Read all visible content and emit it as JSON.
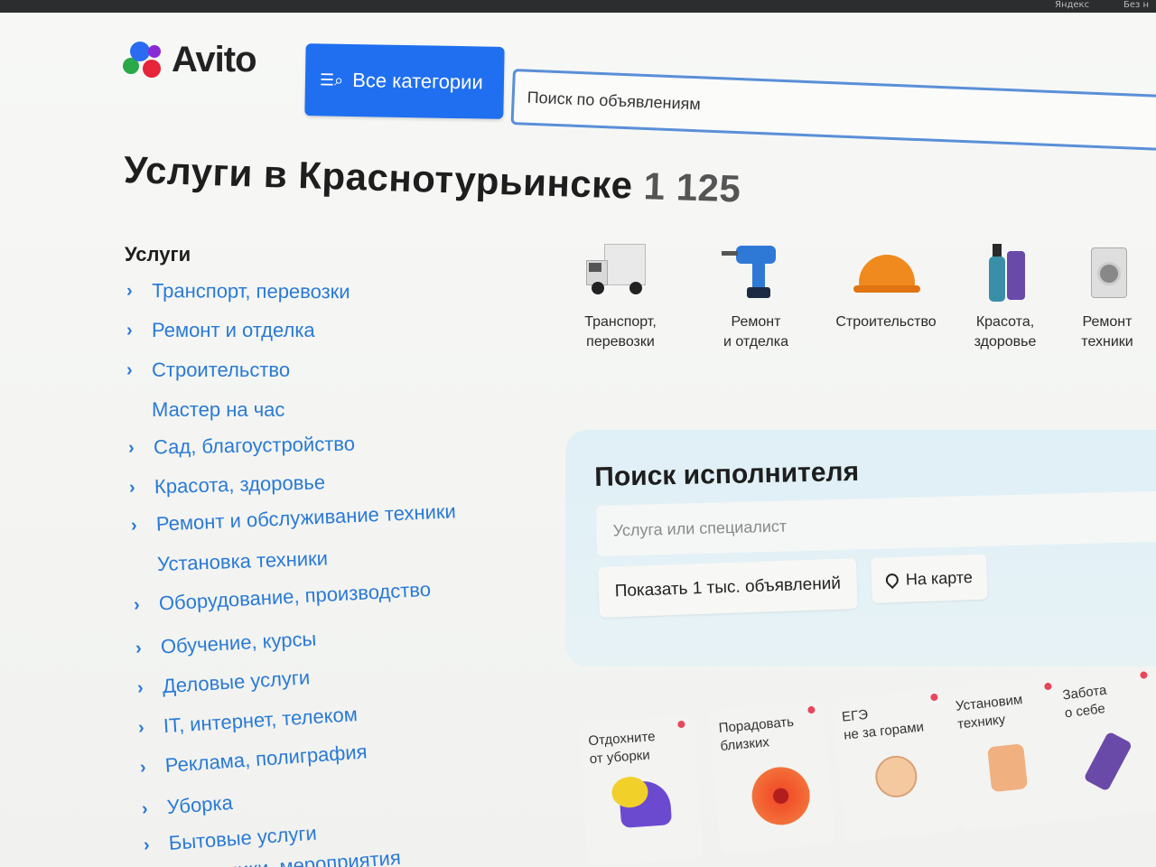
{
  "browser": {
    "bookmarks": [
      "Яндекс",
      "Без н"
    ]
  },
  "header": {
    "logo_text": "Avito",
    "categories_button": "Все категории",
    "search_placeholder": "Поиск по объявлениям"
  },
  "title": {
    "text": "Услуги в Краснотурьинске",
    "count": "1 125"
  },
  "sidebar": {
    "heading": "Услуги",
    "items": [
      {
        "label": "Транспорт, перевозки",
        "chevron": true
      },
      {
        "label": "Ремонт и отделка",
        "chevron": true
      },
      {
        "label": "Строительство",
        "chevron": true
      },
      {
        "label": "Мастер на час",
        "chevron": false
      },
      {
        "label": "Сад, благоустройство",
        "chevron": true
      },
      {
        "label": "Красота, здоровье",
        "chevron": true
      },
      {
        "label": "Ремонт и обслуживание техники",
        "chevron": true
      },
      {
        "label": "Установка техники",
        "chevron": false
      },
      {
        "label": "Оборудование, производство",
        "chevron": true
      },
      {
        "label": "Обучение, курсы",
        "chevron": true
      },
      {
        "label": "Деловые услуги",
        "chevron": true
      },
      {
        "label": "IT, интернет, телеком",
        "chevron": true
      },
      {
        "label": "Реклама, полиграфия",
        "chevron": true
      },
      {
        "label": "Уборка",
        "chevron": true
      },
      {
        "label": "Бытовые услуги",
        "chevron": true
      },
      {
        "label": "Праздники, мероприятия",
        "chevron": true
      }
    ]
  },
  "tiles": [
    {
      "line1": "Транспорт,",
      "line2": "перевозки",
      "icon": "truck-icon"
    },
    {
      "line1": "Ремонт",
      "line2": "и отделка",
      "icon": "drill-icon"
    },
    {
      "line1": "Строительство",
      "line2": "",
      "icon": "helmet-icon"
    },
    {
      "line1": "Красота,",
      "line2": "здоровье",
      "icon": "cosmetics-icon"
    },
    {
      "line1": "Ремонт",
      "line2": "техники",
      "icon": "washing-machine-icon"
    }
  ],
  "finder": {
    "title": "Поиск исполнителя",
    "input_placeholder": "Услуга или специалист",
    "show_button": "Показать 1 тыс. объявлений",
    "map_button": "На карте"
  },
  "promos": [
    {
      "line1": "Отдохните",
      "line2": "от уборки"
    },
    {
      "line1": "Порадовать",
      "line2": "близких"
    },
    {
      "line1": "ЕГЭ",
      "line2": "не за горами"
    },
    {
      "line1": "Установим",
      "line2": "технику"
    },
    {
      "line1": "Забота",
      "line2": "о себе"
    }
  ],
  "colors": {
    "accent": "#1f6ff0",
    "link": "#2a7ad6",
    "panel": "#dff0f6"
  }
}
